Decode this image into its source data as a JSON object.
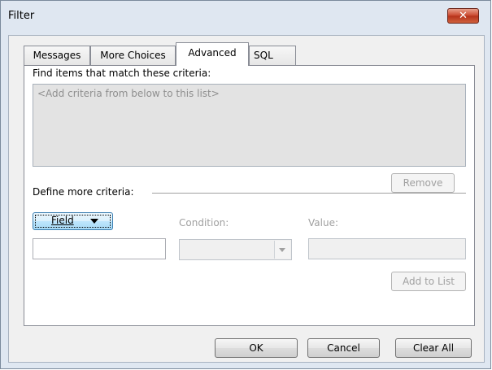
{
  "window": {
    "title": "Filter",
    "close_glyph": "✕"
  },
  "tabs": [
    {
      "label": "Messages",
      "active": false
    },
    {
      "label": "More Choices",
      "active": false
    },
    {
      "label": "Advanced",
      "active": true
    },
    {
      "label": "SQL",
      "active": false
    }
  ],
  "advanced": {
    "find_label": "Find items that match these criteria:",
    "criteria_placeholder": "<Add criteria from below to this list>",
    "remove_label": "Remove",
    "define_label": "Define more criteria:",
    "field_label": "Field",
    "condition_label": "Condition:",
    "value_label": "Value:",
    "field_value": "",
    "condition_value": "",
    "value_value": "",
    "add_label": "Add to List"
  },
  "footer": {
    "ok_label": "OK",
    "cancel_label": "Cancel",
    "clear_label": "Clear All"
  },
  "colors": {
    "close_button": "#c8452b",
    "focus_border": "#3c7fb1",
    "window_frame": "#dfe7f1"
  }
}
